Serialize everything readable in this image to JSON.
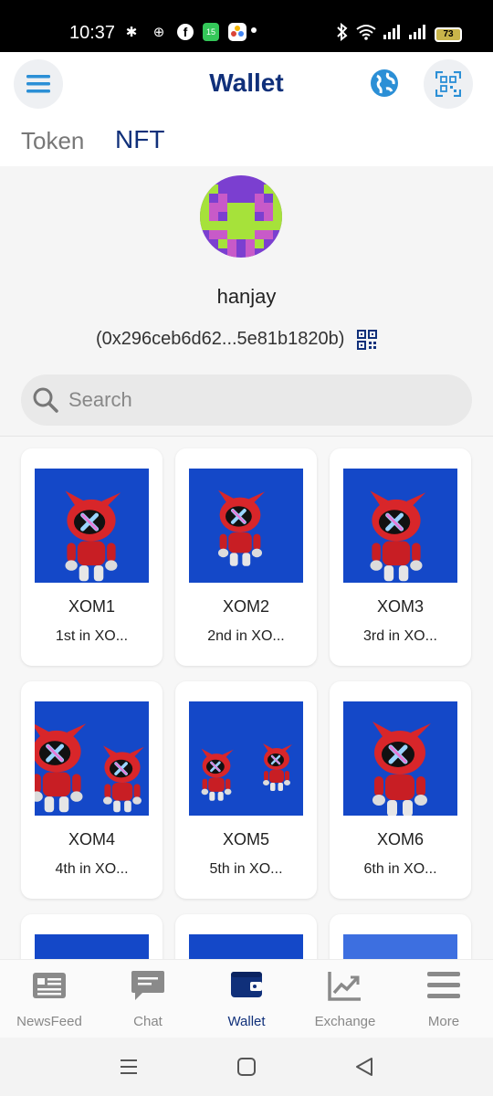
{
  "status_bar": {
    "time": "10:37",
    "battery": "73",
    "calendar_day": "15"
  },
  "header": {
    "title": "Wallet"
  },
  "tabs": [
    {
      "label": "Token"
    },
    {
      "label": "NFT"
    }
  ],
  "profile": {
    "username": "hanjay",
    "address": "(0x296ceb6d62...5e81b1820b)"
  },
  "search": {
    "placeholder": "Search"
  },
  "nfts": [
    {
      "name": "XOM1",
      "desc": "1st in XO..."
    },
    {
      "name": "XOM2",
      "desc": "2nd in XO..."
    },
    {
      "name": "XOM3",
      "desc": "3rd in XO..."
    },
    {
      "name": "XOM4",
      "desc": "4th in XO..."
    },
    {
      "name": "XOM5",
      "desc": "5th in XO..."
    },
    {
      "name": "XOM6",
      "desc": "6th in XO..."
    },
    {
      "name": "",
      "desc": ""
    },
    {
      "name": "",
      "desc": ""
    },
    {
      "name": "",
      "desc": ""
    }
  ],
  "bottom_nav": [
    {
      "label": "NewsFeed",
      "icon": "newsfeed-icon"
    },
    {
      "label": "Chat",
      "icon": "chat-icon"
    },
    {
      "label": "Wallet",
      "icon": "wallet-icon",
      "active": true
    },
    {
      "label": "Exchange",
      "icon": "exchange-icon"
    },
    {
      "label": "More",
      "icon": "more-icon"
    }
  ],
  "colors": {
    "primary": "#10307a",
    "accent_blue": "#2b8fd6",
    "nft_bg": "#1448c8",
    "nav_inactive": "#888888"
  }
}
